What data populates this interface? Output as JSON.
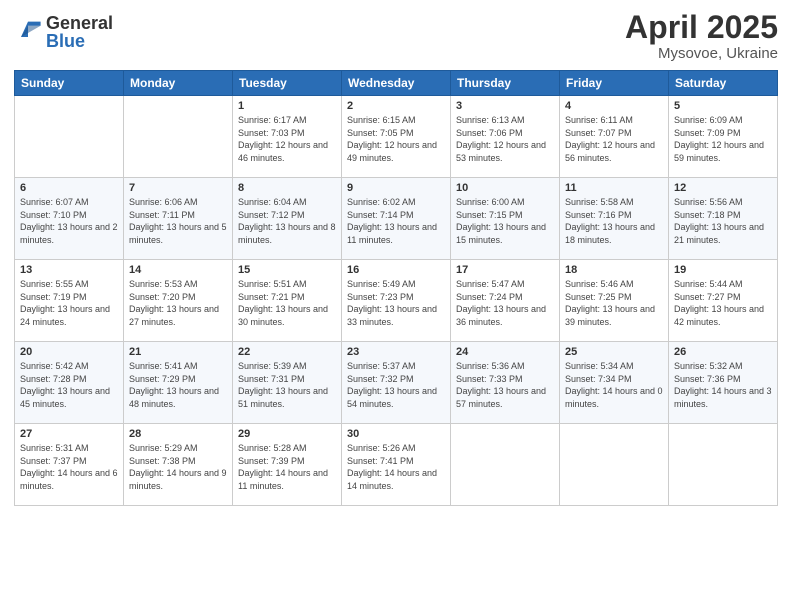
{
  "header": {
    "logo_general": "General",
    "logo_blue": "Blue",
    "title": "April 2025",
    "location": "Mysovoe, Ukraine"
  },
  "weekdays": [
    "Sunday",
    "Monday",
    "Tuesday",
    "Wednesday",
    "Thursday",
    "Friday",
    "Saturday"
  ],
  "weeks": [
    [
      {
        "date": "",
        "info": ""
      },
      {
        "date": "",
        "info": ""
      },
      {
        "date": "1",
        "info": "Sunrise: 6:17 AM\nSunset: 7:03 PM\nDaylight: 12 hours and 46 minutes."
      },
      {
        "date": "2",
        "info": "Sunrise: 6:15 AM\nSunset: 7:05 PM\nDaylight: 12 hours and 49 minutes."
      },
      {
        "date": "3",
        "info": "Sunrise: 6:13 AM\nSunset: 7:06 PM\nDaylight: 12 hours and 53 minutes."
      },
      {
        "date": "4",
        "info": "Sunrise: 6:11 AM\nSunset: 7:07 PM\nDaylight: 12 hours and 56 minutes."
      },
      {
        "date": "5",
        "info": "Sunrise: 6:09 AM\nSunset: 7:09 PM\nDaylight: 12 hours and 59 minutes."
      }
    ],
    [
      {
        "date": "6",
        "info": "Sunrise: 6:07 AM\nSunset: 7:10 PM\nDaylight: 13 hours and 2 minutes."
      },
      {
        "date": "7",
        "info": "Sunrise: 6:06 AM\nSunset: 7:11 PM\nDaylight: 13 hours and 5 minutes."
      },
      {
        "date": "8",
        "info": "Sunrise: 6:04 AM\nSunset: 7:12 PM\nDaylight: 13 hours and 8 minutes."
      },
      {
        "date": "9",
        "info": "Sunrise: 6:02 AM\nSunset: 7:14 PM\nDaylight: 13 hours and 11 minutes."
      },
      {
        "date": "10",
        "info": "Sunrise: 6:00 AM\nSunset: 7:15 PM\nDaylight: 13 hours and 15 minutes."
      },
      {
        "date": "11",
        "info": "Sunrise: 5:58 AM\nSunset: 7:16 PM\nDaylight: 13 hours and 18 minutes."
      },
      {
        "date": "12",
        "info": "Sunrise: 5:56 AM\nSunset: 7:18 PM\nDaylight: 13 hours and 21 minutes."
      }
    ],
    [
      {
        "date": "13",
        "info": "Sunrise: 5:55 AM\nSunset: 7:19 PM\nDaylight: 13 hours and 24 minutes."
      },
      {
        "date": "14",
        "info": "Sunrise: 5:53 AM\nSunset: 7:20 PM\nDaylight: 13 hours and 27 minutes."
      },
      {
        "date": "15",
        "info": "Sunrise: 5:51 AM\nSunset: 7:21 PM\nDaylight: 13 hours and 30 minutes."
      },
      {
        "date": "16",
        "info": "Sunrise: 5:49 AM\nSunset: 7:23 PM\nDaylight: 13 hours and 33 minutes."
      },
      {
        "date": "17",
        "info": "Sunrise: 5:47 AM\nSunset: 7:24 PM\nDaylight: 13 hours and 36 minutes."
      },
      {
        "date": "18",
        "info": "Sunrise: 5:46 AM\nSunset: 7:25 PM\nDaylight: 13 hours and 39 minutes."
      },
      {
        "date": "19",
        "info": "Sunrise: 5:44 AM\nSunset: 7:27 PM\nDaylight: 13 hours and 42 minutes."
      }
    ],
    [
      {
        "date": "20",
        "info": "Sunrise: 5:42 AM\nSunset: 7:28 PM\nDaylight: 13 hours and 45 minutes."
      },
      {
        "date": "21",
        "info": "Sunrise: 5:41 AM\nSunset: 7:29 PM\nDaylight: 13 hours and 48 minutes."
      },
      {
        "date": "22",
        "info": "Sunrise: 5:39 AM\nSunset: 7:31 PM\nDaylight: 13 hours and 51 minutes."
      },
      {
        "date": "23",
        "info": "Sunrise: 5:37 AM\nSunset: 7:32 PM\nDaylight: 13 hours and 54 minutes."
      },
      {
        "date": "24",
        "info": "Sunrise: 5:36 AM\nSunset: 7:33 PM\nDaylight: 13 hours and 57 minutes."
      },
      {
        "date": "25",
        "info": "Sunrise: 5:34 AM\nSunset: 7:34 PM\nDaylight: 14 hours and 0 minutes."
      },
      {
        "date": "26",
        "info": "Sunrise: 5:32 AM\nSunset: 7:36 PM\nDaylight: 14 hours and 3 minutes."
      }
    ],
    [
      {
        "date": "27",
        "info": "Sunrise: 5:31 AM\nSunset: 7:37 PM\nDaylight: 14 hours and 6 minutes."
      },
      {
        "date": "28",
        "info": "Sunrise: 5:29 AM\nSunset: 7:38 PM\nDaylight: 14 hours and 9 minutes."
      },
      {
        "date": "29",
        "info": "Sunrise: 5:28 AM\nSunset: 7:39 PM\nDaylight: 14 hours and 11 minutes."
      },
      {
        "date": "30",
        "info": "Sunrise: 5:26 AM\nSunset: 7:41 PM\nDaylight: 14 hours and 14 minutes."
      },
      {
        "date": "",
        "info": ""
      },
      {
        "date": "",
        "info": ""
      },
      {
        "date": "",
        "info": ""
      }
    ]
  ]
}
